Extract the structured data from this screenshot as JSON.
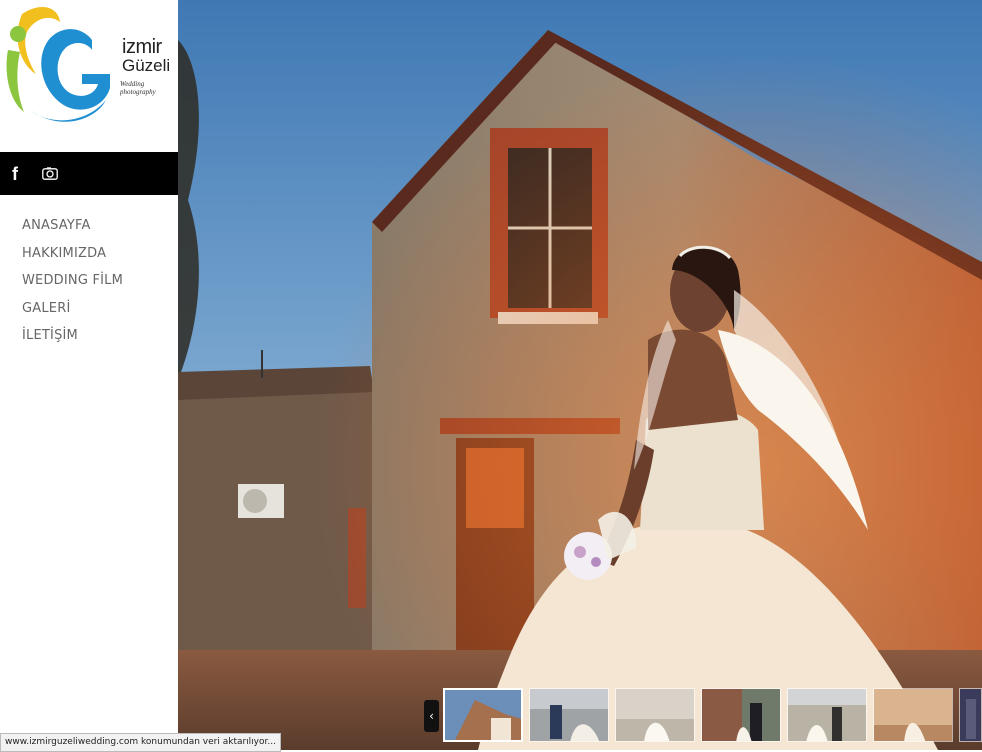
{
  "brand": {
    "line1": "izmir",
    "line2": "Güzeli",
    "tagline": "Wedding photography"
  },
  "social": {
    "facebook_icon": "facebook-icon",
    "instagram_icon": "instagram-icon"
  },
  "nav": {
    "items": [
      {
        "label": "ANASAYFA"
      },
      {
        "label": "HAKKIMIZDA"
      },
      {
        "label": "WEDDING FİLM"
      },
      {
        "label": "GALERİ"
      },
      {
        "label": "İLETİŞİM"
      }
    ]
  },
  "gallery": {
    "prev_label": "‹"
  },
  "status": {
    "text": "www.izmirguzeliwedding.com konumundan veri aktarılıyor..."
  },
  "colors": {
    "logo_yellow": "#f2c01e",
    "logo_green": "#8cc63f",
    "logo_blue": "#1f8fd1",
    "nav_text": "#666666",
    "social_bar": "#000000"
  }
}
